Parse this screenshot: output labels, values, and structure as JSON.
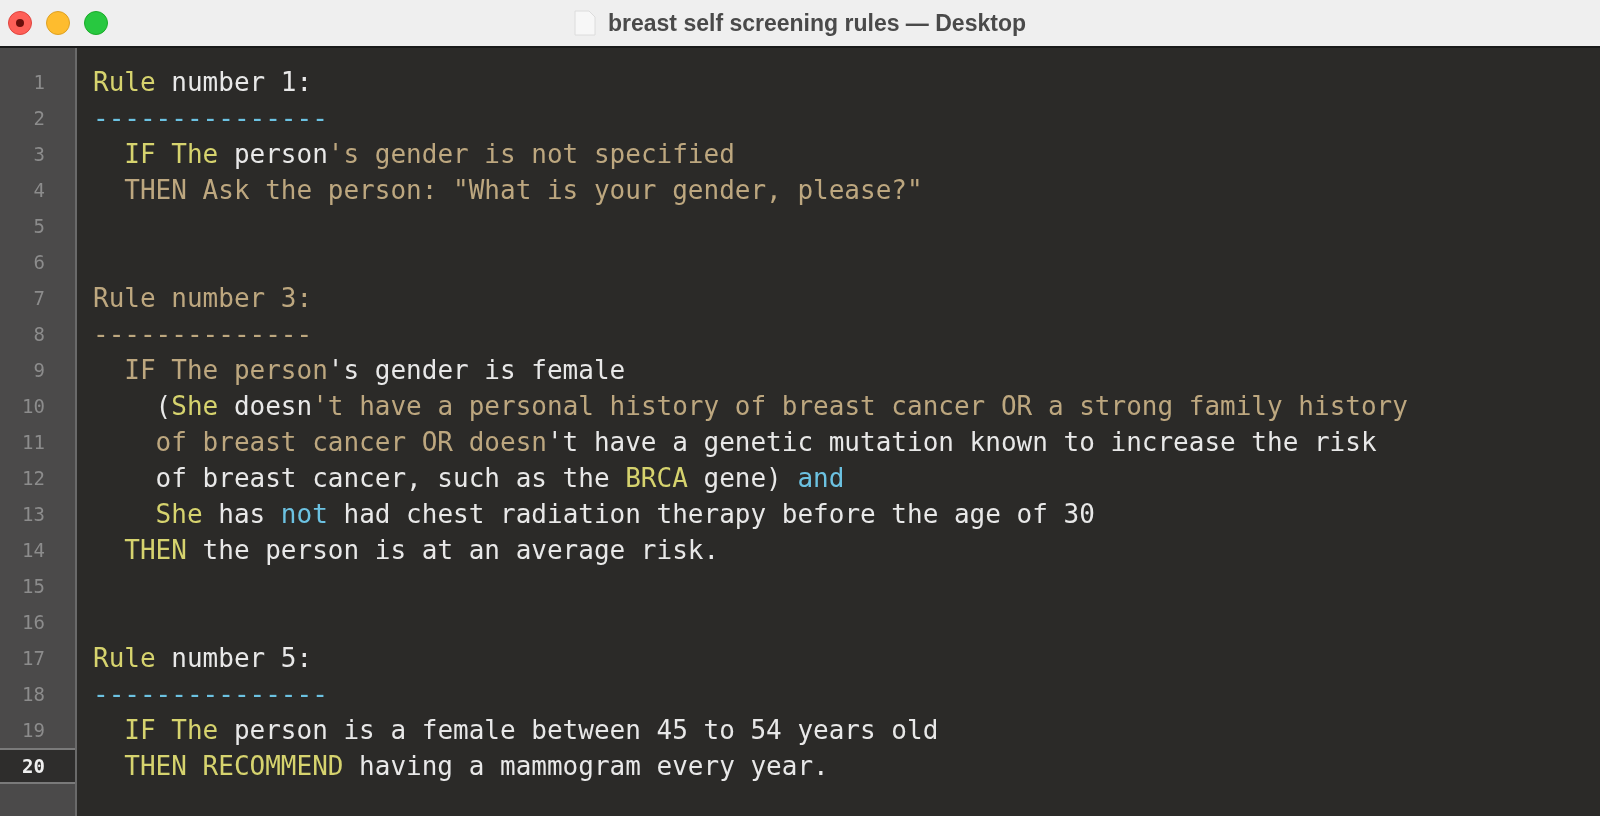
{
  "window": {
    "title": "breast self screening rules — Desktop"
  },
  "lines": [
    {
      "number": "1",
      "current": false,
      "tokens": [
        {
          "kind": "keyword",
          "text": "Rule"
        },
        {
          "kind": "plain",
          "text": " number 1:"
        }
      ]
    },
    {
      "number": "2",
      "current": false,
      "tokens": [
        {
          "kind": "operator",
          "text": "---------------"
        }
      ]
    },
    {
      "number": "3",
      "current": false,
      "tokens": [
        {
          "kind": "keyword",
          "text": "  IF The"
        },
        {
          "kind": "plain",
          "text": " person"
        },
        {
          "kind": "string",
          "text": "'s gender is not specified"
        }
      ]
    },
    {
      "number": "4",
      "current": false,
      "tokens": [
        {
          "kind": "string",
          "text": "  THEN Ask the person: \"What is your gender, please?\""
        }
      ]
    },
    {
      "number": "5",
      "current": false
    },
    {
      "number": "6",
      "current": false
    },
    {
      "number": "7",
      "current": false,
      "tokens": [
        {
          "kind": "string",
          "text": "Rule number 3:"
        }
      ]
    },
    {
      "number": "8",
      "current": false,
      "tokens": [
        {
          "kind": "string",
          "text": "--------------"
        }
      ]
    },
    {
      "number": "9",
      "current": false,
      "tokens": [
        {
          "kind": "string",
          "text": "  IF The person"
        },
        {
          "kind": "plain",
          "text": "'s gender is female"
        }
      ]
    },
    {
      "number": "10",
      "current": false,
      "tokens": [
        {
          "kind": "plain",
          "text": "    ("
        },
        {
          "kind": "keyword",
          "text": "She"
        },
        {
          "kind": "plain",
          "text": " doesn"
        },
        {
          "kind": "string",
          "text": "'t have a personal history of breast cancer OR a strong family history"
        }
      ]
    },
    {
      "number": "11",
      "current": false,
      "tokens": [
        {
          "kind": "string",
          "text": "    of breast cancer OR doesn"
        },
        {
          "kind": "plain",
          "text": "'t have a genetic mutation known to increase the risk"
        }
      ]
    },
    {
      "number": "12",
      "current": false,
      "tokens": [
        {
          "kind": "plain",
          "text": "    of breast cancer, such as the "
        },
        {
          "kind": "keyword",
          "text": "BRCA"
        },
        {
          "kind": "plain",
          "text": " gene) "
        },
        {
          "kind": "operator",
          "text": "and"
        }
      ]
    },
    {
      "number": "13",
      "current": false,
      "tokens": [
        {
          "kind": "keyword",
          "text": "    She"
        },
        {
          "kind": "plain",
          "text": " has "
        },
        {
          "kind": "operator",
          "text": "not"
        },
        {
          "kind": "plain",
          "text": " had chest radiation therapy before the age of 30"
        }
      ]
    },
    {
      "number": "14",
      "current": false,
      "tokens": [
        {
          "kind": "keyword",
          "text": "  THEN"
        },
        {
          "kind": "plain",
          "text": " the person is at an average risk."
        }
      ]
    },
    {
      "number": "15",
      "current": false
    },
    {
      "number": "16",
      "current": false
    },
    {
      "number": "17",
      "current": false,
      "tokens": [
        {
          "kind": "keyword",
          "text": "Rule"
        },
        {
          "kind": "plain",
          "text": " number 5:"
        }
      ]
    },
    {
      "number": "18",
      "current": false,
      "tokens": [
        {
          "kind": "operator",
          "text": "---------------"
        }
      ]
    },
    {
      "number": "19",
      "current": false,
      "tokens": [
        {
          "kind": "keyword",
          "text": "  IF The"
        },
        {
          "kind": "plain",
          "text": " person is a female between 45 to 54 years old"
        }
      ]
    },
    {
      "number": "20",
      "current": true,
      "tokens": [
        {
          "kind": "keyword",
          "text": "  THEN RECOMMEND"
        },
        {
          "kind": "plain",
          "text": " having a mammogram every year."
        }
      ]
    }
  ]
}
